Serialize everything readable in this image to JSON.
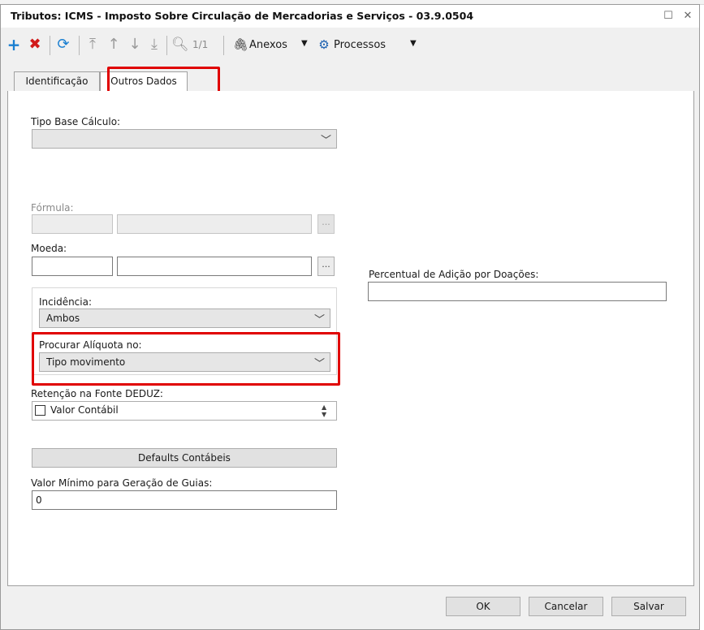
{
  "window": {
    "title": "Tributos: ICMS - Imposto Sobre Circulação de Mercadorias e Serviços - 03.9.0504"
  },
  "toolbar": {
    "page_indicator": "1/1",
    "anexos_label": "Anexos",
    "processos_label": "Processos"
  },
  "tabs": [
    {
      "label": "Identificação"
    },
    {
      "label": "Outros Dados"
    }
  ],
  "form": {
    "tipo_base_calculo_label": "Tipo Base Cálculo:",
    "tipo_base_calculo_value": "",
    "formula_label": "Fórmula:",
    "formula_code": "",
    "formula_desc": "",
    "moeda_label": "Moeda:",
    "moeda_code": "",
    "moeda_desc": "",
    "dots_label": "...",
    "percentual_label": "Percentual de Adição por Doações:",
    "percentual_value": "",
    "incidencia_label": "Incidência:",
    "incidencia_value": "Ambos",
    "procurar_label": "Procurar Alíquota no:",
    "procurar_value": "Tipo movimento",
    "retencao_label": "Retenção na Fonte DEDUZ:",
    "retencao_option": "Valor Contábil",
    "defaults_button": "Defaults Contábeis",
    "valor_minimo_label": "Valor Mínimo para Geração de Guias:",
    "valor_minimo_value": "0"
  },
  "buttons": {
    "ok": "OK",
    "cancelar": "Cancelar",
    "salvar": "Salvar"
  },
  "colors": {
    "add": "#1a7fd1",
    "delete": "#d11a1a",
    "refresh": "#1a7fd1",
    "highlight": "#e00000"
  }
}
